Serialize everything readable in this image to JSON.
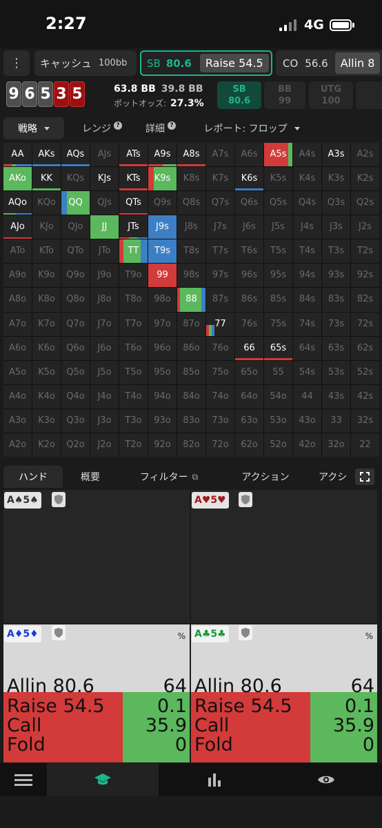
{
  "status": {
    "time": "2:27",
    "network": "4G"
  },
  "header": {
    "menu_icon": "more-vert-icon",
    "game": "キャッシュ",
    "stack": "100bb",
    "sb_pos": "SB",
    "sb_value": "80.6",
    "sb_action": "Raise 54.5",
    "co_pos": "CO",
    "co_value": "56.6",
    "co_action": "Allin 8"
  },
  "board": [
    {
      "rank": "9",
      "color": "gray"
    },
    {
      "rank": "6",
      "color": "gray"
    },
    {
      "rank": "5",
      "color": "gray"
    },
    {
      "rank": "3",
      "color": "red"
    },
    {
      "rank": "5",
      "color": "red"
    }
  ],
  "pot": {
    "main": "63.8 BB",
    "side": "39.8 BB",
    "odds_label": "ポットオッズ:",
    "odds_value": "27.3%"
  },
  "seats": [
    {
      "pos": "SB",
      "stack": "80.6",
      "state": "active"
    },
    {
      "pos": "BB",
      "stack": "99",
      "state": "inactive"
    },
    {
      "pos": "UTG",
      "stack": "100",
      "state": "inactive"
    }
  ],
  "tabs": {
    "strategy": "戦略",
    "range": "レンジ",
    "detail": "詳細",
    "report": "レポート: フロップ"
  },
  "colors": {
    "allin": "#d33a3a",
    "raise": "#d33a3a",
    "call": "#5cb85c",
    "check": "#3d7fc4",
    "accent": "#1db58c"
  },
  "grid": [
    [
      {
        "h": "AA",
        "a": [
          [
            "r",
            0.3
          ],
          [
            "g",
            0.15
          ],
          [
            "b",
            0.55
          ]
        ]
      },
      {
        "h": "AKs",
        "a": [
          [
            "b",
            1
          ]
        ]
      },
      {
        "h": "AQs",
        "a": [
          [
            "b",
            1
          ]
        ]
      },
      {
        "h": "AJs"
      },
      {
        "h": "ATs",
        "a": [
          [
            "r",
            1
          ]
        ]
      },
      {
        "h": "A9s",
        "a": [
          [
            "r",
            0.5
          ],
          [
            "g",
            0.5
          ]
        ]
      },
      {
        "h": "A8s",
        "a": [
          [
            "r",
            1
          ]
        ]
      },
      {
        "h": "A7s"
      },
      {
        "h": "A6s"
      },
      {
        "h": "A5s",
        "a": [
          [
            "r",
            0.85
          ],
          [
            "g",
            0.15
          ]
        ],
        "f": 1
      },
      {
        "h": "A4s"
      },
      {
        "h": "A3s",
        "wh": 1
      },
      {
        "h": "A2s"
      }
    ],
    [
      {
        "h": "AKo",
        "a": [
          [
            "g",
            1
          ]
        ],
        "f": 1
      },
      {
        "h": "KK",
        "a": [
          [
            "g",
            1
          ]
        ]
      },
      {
        "h": "KQs"
      },
      {
        "h": "KJs",
        "wh": 1
      },
      {
        "h": "KTs",
        "a": [
          [
            "r",
            1
          ]
        ]
      },
      {
        "h": "K9s",
        "a": [
          [
            "r",
            0.2
          ],
          [
            "g",
            0.8
          ]
        ],
        "f": 1
      },
      {
        "h": "K8s"
      },
      {
        "h": "K7s"
      },
      {
        "h": "K6s",
        "a": [
          [
            "b",
            1
          ]
        ]
      },
      {
        "h": "K5s"
      },
      {
        "h": "K4s"
      },
      {
        "h": "K3s"
      },
      {
        "h": "K2s"
      }
    ],
    [
      {
        "h": "AQo",
        "a": [
          [
            "g",
            0.45
          ],
          [
            "b",
            0.55
          ]
        ]
      },
      {
        "h": "KQo"
      },
      {
        "h": "QQ",
        "a": [
          [
            "b",
            0.2
          ],
          [
            "g",
            0.8
          ]
        ],
        "f": 1
      },
      {
        "h": "QJs"
      },
      {
        "h": "QTs",
        "a": [
          [
            "r",
            1
          ]
        ]
      },
      {
        "h": "Q9s"
      },
      {
        "h": "Q8s"
      },
      {
        "h": "Q7s"
      },
      {
        "h": "Q6s"
      },
      {
        "h": "Q5s"
      },
      {
        "h": "Q4s"
      },
      {
        "h": "Q3s"
      },
      {
        "h": "Q2s"
      }
    ],
    [
      {
        "h": "AJo",
        "a": [
          [
            "r",
            1
          ]
        ]
      },
      {
        "h": "KJo"
      },
      {
        "h": "QJo"
      },
      {
        "h": "JJ",
        "a": [
          [
            "g",
            1
          ]
        ],
        "f": 1
      },
      {
        "h": "JTs",
        "a": [
          [
            "r",
            0.35
          ],
          [
            "g",
            0.3
          ],
          [
            "b",
            0.35
          ]
        ]
      },
      {
        "h": "J9s",
        "a": [
          [
            "b",
            1
          ]
        ],
        "f": 1
      },
      {
        "h": "J8s"
      },
      {
        "h": "J7s"
      },
      {
        "h": "J6s"
      },
      {
        "h": "J5s"
      },
      {
        "h": "J4s"
      },
      {
        "h": "J3s"
      },
      {
        "h": "J2s"
      }
    ],
    [
      {
        "h": "ATo"
      },
      {
        "h": "KTo"
      },
      {
        "h": "QTo"
      },
      {
        "h": "JTo"
      },
      {
        "h": "TT",
        "a": [
          [
            "r",
            0.15
          ],
          [
            "g",
            0.6
          ],
          [
            "b",
            0.25
          ]
        ],
        "f": 1
      },
      {
        "h": "T9s",
        "a": [
          [
            "b",
            1
          ]
        ],
        "f": 1
      },
      {
        "h": "T8s"
      },
      {
        "h": "T7s"
      },
      {
        "h": "T6s"
      },
      {
        "h": "T5s"
      },
      {
        "h": "T4s"
      },
      {
        "h": "T3s"
      },
      {
        "h": "T2s"
      }
    ],
    [
      {
        "h": "A9o"
      },
      {
        "h": "K9o"
      },
      {
        "h": "Q9o"
      },
      {
        "h": "J9o"
      },
      {
        "h": "T9o"
      },
      {
        "h": "99",
        "a": [
          [
            "r",
            1
          ]
        ],
        "f": 1
      },
      {
        "h": "98s"
      },
      {
        "h": "97s"
      },
      {
        "h": "96s"
      },
      {
        "h": "95s"
      },
      {
        "h": "94s"
      },
      {
        "h": "93s"
      },
      {
        "h": "92s"
      }
    ],
    [
      {
        "h": "A8o"
      },
      {
        "h": "K8o"
      },
      {
        "h": "Q8o"
      },
      {
        "h": "J8o"
      },
      {
        "h": "T8o"
      },
      {
        "h": "98o"
      },
      {
        "h": "88",
        "a": [
          [
            "r",
            0.1
          ],
          [
            "g",
            0.75
          ],
          [
            "b",
            0.15
          ]
        ],
        "f": 1
      },
      {
        "h": "87s"
      },
      {
        "h": "86s"
      },
      {
        "h": "85s"
      },
      {
        "h": "84s"
      },
      {
        "h": "83s"
      },
      {
        "h": "82s"
      }
    ],
    [
      {
        "h": "A7o"
      },
      {
        "h": "K7o"
      },
      {
        "h": "Q7o"
      },
      {
        "h": "J7o"
      },
      {
        "h": "T7o"
      },
      {
        "h": "97o"
      },
      {
        "h": "87o"
      },
      {
        "h": "77",
        "a": [
          [
            "r",
            0.1
          ],
          [
            "g",
            0.1
          ],
          [
            "b",
            0.1
          ]
        ],
        "p": 0.45,
        "wh": 1
      },
      {
        "h": "76s"
      },
      {
        "h": "75s"
      },
      {
        "h": "74s"
      },
      {
        "h": "73s"
      },
      {
        "h": "72s"
      }
    ],
    [
      {
        "h": "A6o"
      },
      {
        "h": "K6o"
      },
      {
        "h": "Q6o"
      },
      {
        "h": "J6o"
      },
      {
        "h": "T6o"
      },
      {
        "h": "96o"
      },
      {
        "h": "86o"
      },
      {
        "h": "76o"
      },
      {
        "h": "66",
        "a": [
          [
            "r",
            1
          ]
        ]
      },
      {
        "h": "65s",
        "a": [
          [
            "r",
            1
          ]
        ]
      },
      {
        "h": "64s"
      },
      {
        "h": "63s"
      },
      {
        "h": "62s"
      }
    ],
    [
      {
        "h": "A5o"
      },
      {
        "h": "K5o"
      },
      {
        "h": "Q5o"
      },
      {
        "h": "J5o"
      },
      {
        "h": "T5o"
      },
      {
        "h": "95o"
      },
      {
        "h": "85o"
      },
      {
        "h": "75o"
      },
      {
        "h": "65o"
      },
      {
        "h": "55"
      },
      {
        "h": "54s"
      },
      {
        "h": "53s"
      },
      {
        "h": "52s"
      }
    ],
    [
      {
        "h": "A4o"
      },
      {
        "h": "K4o"
      },
      {
        "h": "Q4o"
      },
      {
        "h": "J4o"
      },
      {
        "h": "T4o"
      },
      {
        "h": "94o"
      },
      {
        "h": "84o"
      },
      {
        "h": "74o"
      },
      {
        "h": "64o"
      },
      {
        "h": "54o"
      },
      {
        "h": "44"
      },
      {
        "h": "43s"
      },
      {
        "h": "42s"
      }
    ],
    [
      {
        "h": "A3o"
      },
      {
        "h": "K3o"
      },
      {
        "h": "Q3o"
      },
      {
        "h": "J3o"
      },
      {
        "h": "T3o"
      },
      {
        "h": "93o"
      },
      {
        "h": "83o"
      },
      {
        "h": "73o"
      },
      {
        "h": "63o"
      },
      {
        "h": "53o"
      },
      {
        "h": "43o"
      },
      {
        "h": "33"
      },
      {
        "h": "32s"
      }
    ],
    [
      {
        "h": "A2o"
      },
      {
        "h": "K2o"
      },
      {
        "h": "Q2o"
      },
      {
        "h": "J2o"
      },
      {
        "h": "T2o"
      },
      {
        "h": "92o"
      },
      {
        "h": "82o"
      },
      {
        "h": "72o"
      },
      {
        "h": "62o"
      },
      {
        "h": "52o"
      },
      {
        "h": "42o"
      },
      {
        "h": "32o"
      },
      {
        "h": "22"
      }
    ]
  ],
  "lower_tabs": {
    "hand": "ハンド",
    "summary": "概要",
    "filter": "フィルター",
    "action": "アクション",
    "action2": "アクシ"
  },
  "hands": {
    "tl": {
      "rank1": "A",
      "suit1": "♠",
      "rank2": "5",
      "suit2": "♠"
    },
    "tr": {
      "rank1": "A",
      "suit1": "♥",
      "rank2": "5",
      "suit2": "♥"
    },
    "bl": {
      "rank1": "A",
      "suit1": "♦",
      "rank2": "5",
      "suit2": "♦",
      "pct": "%",
      "rows": [
        {
          "label": "Allin 80.6",
          "value": "64"
        },
        {
          "label": "Raise 54.5",
          "value": "0.1"
        },
        {
          "label": "Call",
          "value": "35.9"
        },
        {
          "label": "Fold",
          "value": "0"
        }
      ]
    },
    "br": {
      "rank1": "A",
      "suit1": "♣",
      "rank2": "5",
      "suit2": "♣",
      "pct": "%",
      "rows": [
        {
          "label": "Allin 80.6",
          "value": "64"
        },
        {
          "label": "Raise 54.5",
          "value": "0.1"
        },
        {
          "label": "Call",
          "value": "35.9"
        },
        {
          "label": "Fold",
          "value": "0"
        }
      ]
    }
  },
  "hand_strategy": {
    "call_fraction": 0.359
  },
  "nav": [
    "menu-icon",
    "study-icon",
    "chart-icon",
    "eye-icon"
  ]
}
